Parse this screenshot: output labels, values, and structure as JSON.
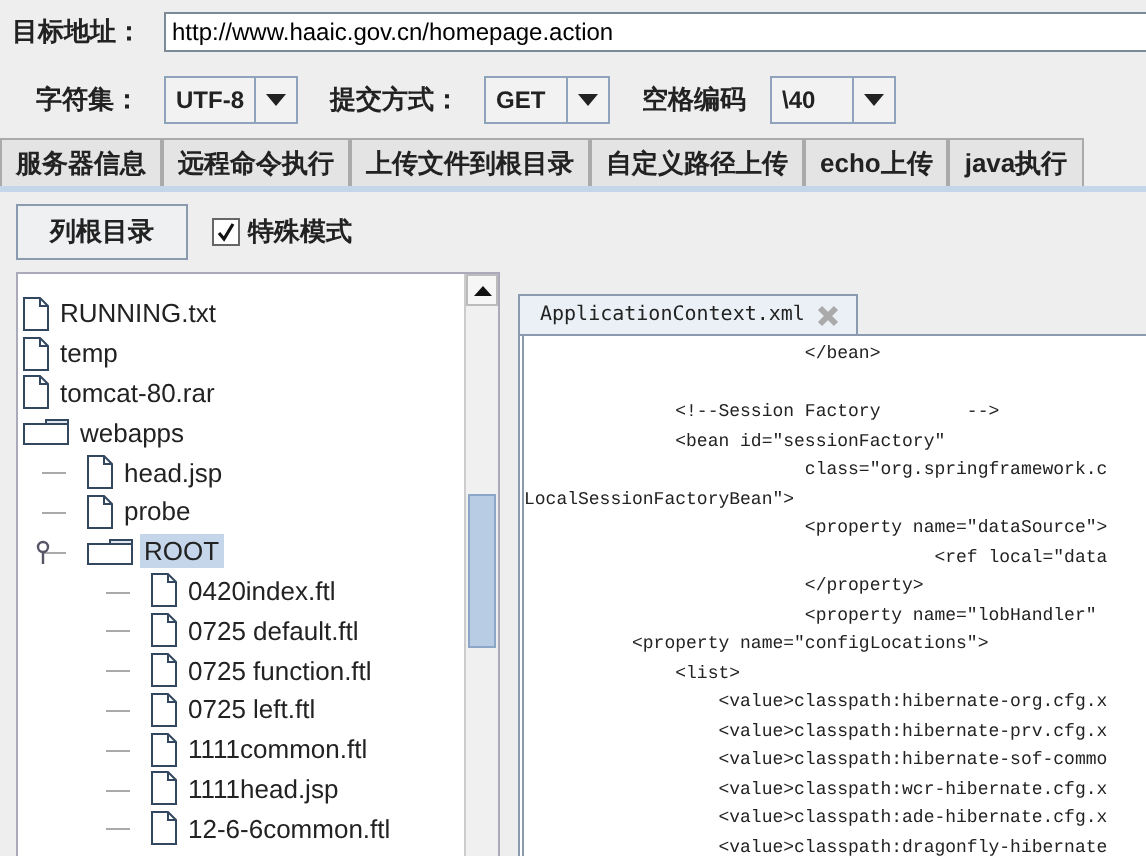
{
  "target": {
    "label": "目标地址：",
    "value": "http://www.haaic.gov.cn/homepage.action"
  },
  "options": [
    {
      "label": "字符集：",
      "value": "UTF-8"
    },
    {
      "label": "提交方式：",
      "value": "GET"
    },
    {
      "label": "空格编码",
      "value": "\\40"
    }
  ],
  "tabs": [
    {
      "label": "服务器信息",
      "selected": false
    },
    {
      "label": "远程命令执行",
      "selected": false
    },
    {
      "label": "上传文件到根目录",
      "selected": false
    },
    {
      "label": "自定义路径上传",
      "selected": false
    },
    {
      "label": "echo上传",
      "selected": false
    },
    {
      "label": "java执行",
      "selected": false
    }
  ],
  "list_root_button": "列根目录",
  "special_mode": {
    "label": "特殊模式",
    "checked": true
  },
  "tree": [
    {
      "kind": "file",
      "name": "RUNNING.txt",
      "selected": false
    },
    {
      "kind": "file",
      "name": "temp",
      "selected": false
    },
    {
      "kind": "file",
      "name": "tomcat-80.rar",
      "selected": false
    },
    {
      "kind": "folder",
      "name": "webapps",
      "selected": false,
      "expanded": true,
      "children": [
        {
          "kind": "file",
          "name": "head.jsp",
          "selected": false
        },
        {
          "kind": "file",
          "name": "probe",
          "selected": false
        },
        {
          "kind": "folder",
          "name": "ROOT",
          "selected": true,
          "expanded": true,
          "children": [
            {
              "kind": "file",
              "name": "0420index.ftl",
              "selected": false
            },
            {
              "kind": "file",
              "name": "0725 default.ftl",
              "selected": false
            },
            {
              "kind": "file",
              "name": "0725 function.ftl",
              "selected": false
            },
            {
              "kind": "file",
              "name": "0725 left.ftl",
              "selected": false
            },
            {
              "kind": "file",
              "name": "1111common.ftl",
              "selected": false
            },
            {
              "kind": "file",
              "name": "1111head.jsp",
              "selected": false
            },
            {
              "kind": "file",
              "name": "12-6-6common.ftl",
              "selected": false
            }
          ]
        }
      ]
    }
  ],
  "editor": {
    "tab": "ApplicationContext.xml",
    "blank_after_first_line": true,
    "lines": [
      "                          </bean>",
      "              <!--Session Factory        -->",
      "              <bean id=\"sessionFactory\"",
      "                          class=\"org.springframework.c",
      "LocalSessionFactoryBean\">",
      "                          <property name=\"dataSource\">",
      "                                      <ref local=\"data",
      "                          </property>",
      "                          <property name=\"lobHandler\"",
      "          <property name=\"configLocations\">",
      "              <list>",
      "                  <value>classpath:hibernate-org.cfg.x",
      "                  <value>classpath:hibernate-prv.cfg.x",
      "                  <value>classpath:hibernate-sof-commo",
      "                  <value>classpath:wcr-hibernate.cfg.x",
      "                  <value>classpath:ade-hibernate.cfg.x",
      "                  <value>classpath:dragonfly-hibernate"
    ]
  }
}
